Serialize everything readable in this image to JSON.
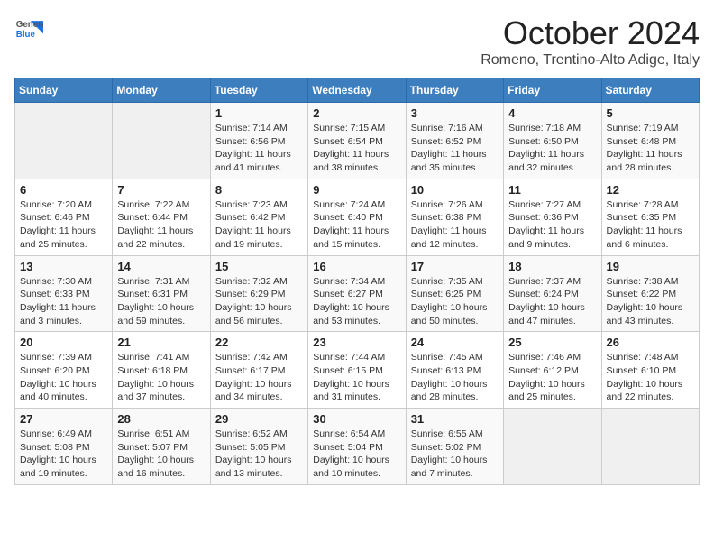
{
  "header": {
    "logo": {
      "general": "General",
      "blue": "Blue"
    },
    "title": "October 2024",
    "location": "Romeno, Trentino-Alto Adige, Italy"
  },
  "weekdays": [
    "Sunday",
    "Monday",
    "Tuesday",
    "Wednesday",
    "Thursday",
    "Friday",
    "Saturday"
  ],
  "weeks": [
    [
      {
        "day": "",
        "info": ""
      },
      {
        "day": "",
        "info": ""
      },
      {
        "day": "1",
        "info": "Sunrise: 7:14 AM\nSunset: 6:56 PM\nDaylight: 11 hours and 41 minutes."
      },
      {
        "day": "2",
        "info": "Sunrise: 7:15 AM\nSunset: 6:54 PM\nDaylight: 11 hours and 38 minutes."
      },
      {
        "day": "3",
        "info": "Sunrise: 7:16 AM\nSunset: 6:52 PM\nDaylight: 11 hours and 35 minutes."
      },
      {
        "day": "4",
        "info": "Sunrise: 7:18 AM\nSunset: 6:50 PM\nDaylight: 11 hours and 32 minutes."
      },
      {
        "day": "5",
        "info": "Sunrise: 7:19 AM\nSunset: 6:48 PM\nDaylight: 11 hours and 28 minutes."
      }
    ],
    [
      {
        "day": "6",
        "info": "Sunrise: 7:20 AM\nSunset: 6:46 PM\nDaylight: 11 hours and 25 minutes."
      },
      {
        "day": "7",
        "info": "Sunrise: 7:22 AM\nSunset: 6:44 PM\nDaylight: 11 hours and 22 minutes."
      },
      {
        "day": "8",
        "info": "Sunrise: 7:23 AM\nSunset: 6:42 PM\nDaylight: 11 hours and 19 minutes."
      },
      {
        "day": "9",
        "info": "Sunrise: 7:24 AM\nSunset: 6:40 PM\nDaylight: 11 hours and 15 minutes."
      },
      {
        "day": "10",
        "info": "Sunrise: 7:26 AM\nSunset: 6:38 PM\nDaylight: 11 hours and 12 minutes."
      },
      {
        "day": "11",
        "info": "Sunrise: 7:27 AM\nSunset: 6:36 PM\nDaylight: 11 hours and 9 minutes."
      },
      {
        "day": "12",
        "info": "Sunrise: 7:28 AM\nSunset: 6:35 PM\nDaylight: 11 hours and 6 minutes."
      }
    ],
    [
      {
        "day": "13",
        "info": "Sunrise: 7:30 AM\nSunset: 6:33 PM\nDaylight: 11 hours and 3 minutes."
      },
      {
        "day": "14",
        "info": "Sunrise: 7:31 AM\nSunset: 6:31 PM\nDaylight: 10 hours and 59 minutes."
      },
      {
        "day": "15",
        "info": "Sunrise: 7:32 AM\nSunset: 6:29 PM\nDaylight: 10 hours and 56 minutes."
      },
      {
        "day": "16",
        "info": "Sunrise: 7:34 AM\nSunset: 6:27 PM\nDaylight: 10 hours and 53 minutes."
      },
      {
        "day": "17",
        "info": "Sunrise: 7:35 AM\nSunset: 6:25 PM\nDaylight: 10 hours and 50 minutes."
      },
      {
        "day": "18",
        "info": "Sunrise: 7:37 AM\nSunset: 6:24 PM\nDaylight: 10 hours and 47 minutes."
      },
      {
        "day": "19",
        "info": "Sunrise: 7:38 AM\nSunset: 6:22 PM\nDaylight: 10 hours and 43 minutes."
      }
    ],
    [
      {
        "day": "20",
        "info": "Sunrise: 7:39 AM\nSunset: 6:20 PM\nDaylight: 10 hours and 40 minutes."
      },
      {
        "day": "21",
        "info": "Sunrise: 7:41 AM\nSunset: 6:18 PM\nDaylight: 10 hours and 37 minutes."
      },
      {
        "day": "22",
        "info": "Sunrise: 7:42 AM\nSunset: 6:17 PM\nDaylight: 10 hours and 34 minutes."
      },
      {
        "day": "23",
        "info": "Sunrise: 7:44 AM\nSunset: 6:15 PM\nDaylight: 10 hours and 31 minutes."
      },
      {
        "day": "24",
        "info": "Sunrise: 7:45 AM\nSunset: 6:13 PM\nDaylight: 10 hours and 28 minutes."
      },
      {
        "day": "25",
        "info": "Sunrise: 7:46 AM\nSunset: 6:12 PM\nDaylight: 10 hours and 25 minutes."
      },
      {
        "day": "26",
        "info": "Sunrise: 7:48 AM\nSunset: 6:10 PM\nDaylight: 10 hours and 22 minutes."
      }
    ],
    [
      {
        "day": "27",
        "info": "Sunrise: 6:49 AM\nSunset: 5:08 PM\nDaylight: 10 hours and 19 minutes."
      },
      {
        "day": "28",
        "info": "Sunrise: 6:51 AM\nSunset: 5:07 PM\nDaylight: 10 hours and 16 minutes."
      },
      {
        "day": "29",
        "info": "Sunrise: 6:52 AM\nSunset: 5:05 PM\nDaylight: 10 hours and 13 minutes."
      },
      {
        "day": "30",
        "info": "Sunrise: 6:54 AM\nSunset: 5:04 PM\nDaylight: 10 hours and 10 minutes."
      },
      {
        "day": "31",
        "info": "Sunrise: 6:55 AM\nSunset: 5:02 PM\nDaylight: 10 hours and 7 minutes."
      },
      {
        "day": "",
        "info": ""
      },
      {
        "day": "",
        "info": ""
      }
    ]
  ]
}
